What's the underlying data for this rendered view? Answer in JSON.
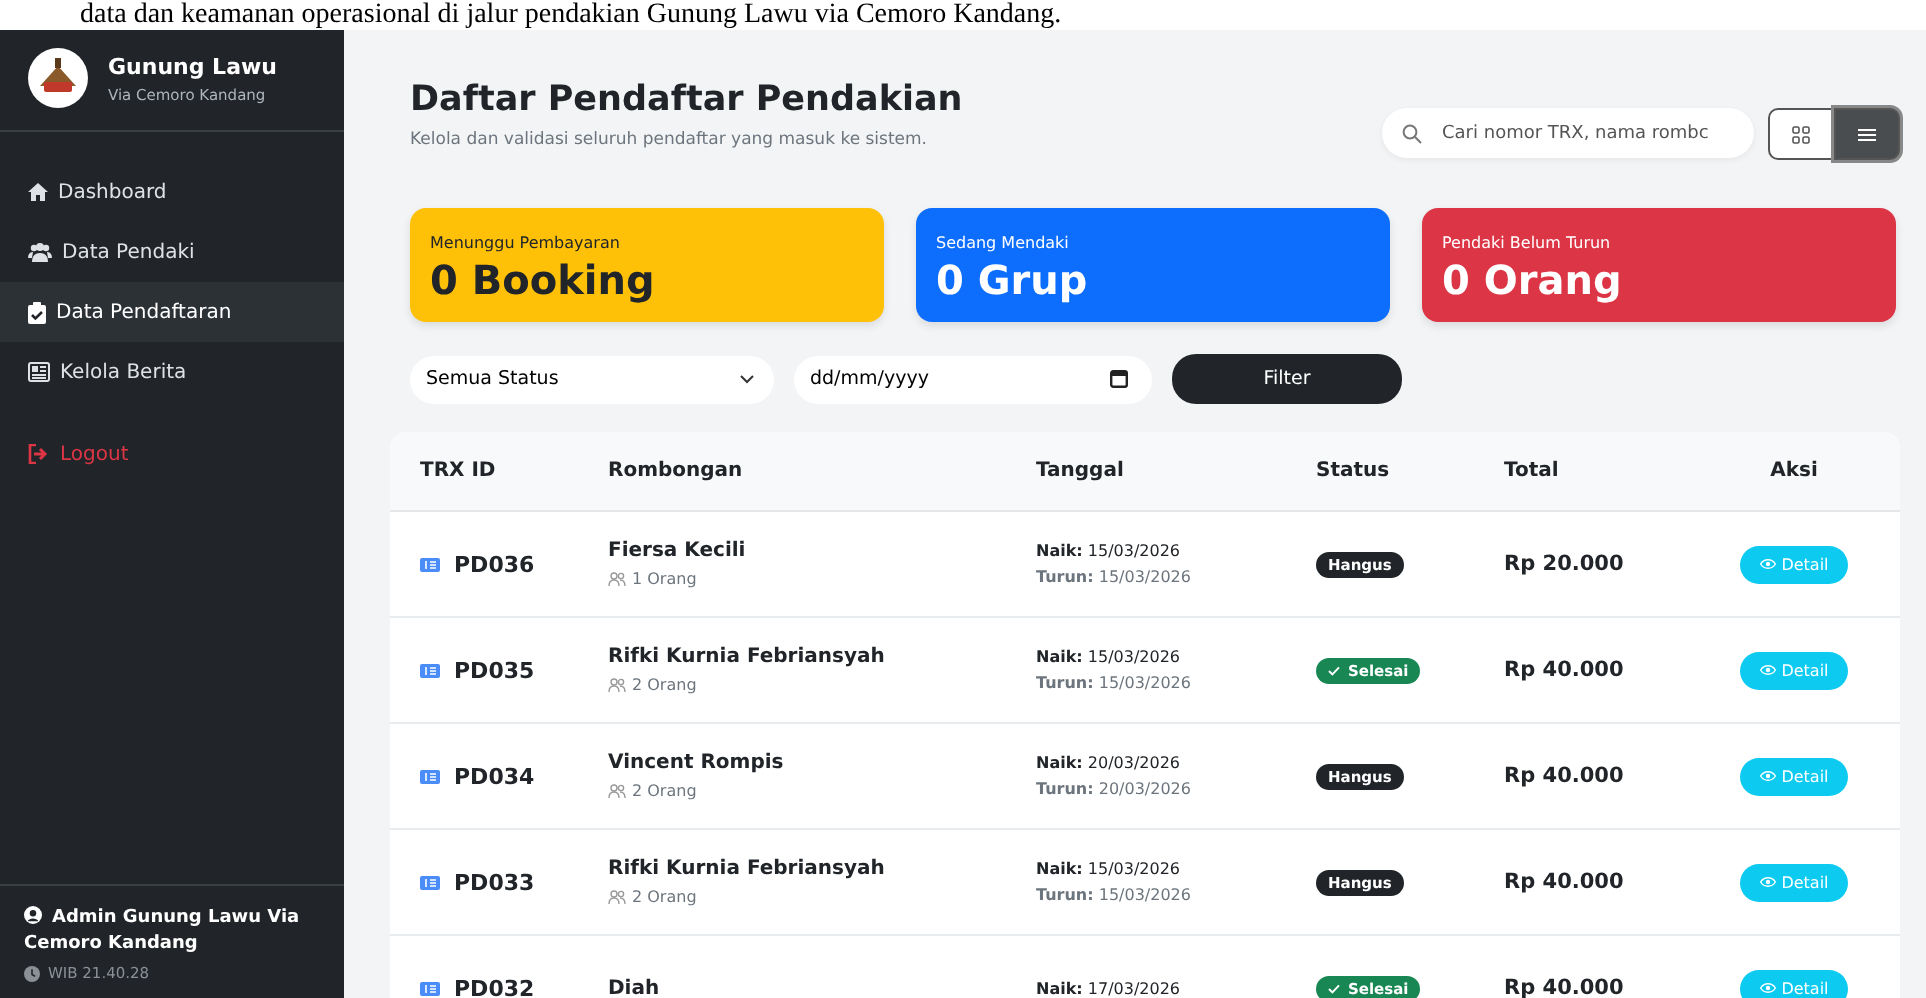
{
  "caption": "data dan keamanan operasional di jalur pendakian Gunung Lawu via Cemoro Kandang.",
  "sidebar": {
    "brand": {
      "title": "Gunung Lawu",
      "subtitle": "Via Cemoro Kandang"
    },
    "items": [
      {
        "label": "Dashboard",
        "kind": "link",
        "selected": false
      },
      {
        "label": "Data Pendaki",
        "kind": "link",
        "selected": false
      },
      {
        "label": "Data Pendaftaran",
        "kind": "link",
        "selected": true
      },
      {
        "label": "Kelola Berita",
        "kind": "link",
        "selected": false
      },
      {
        "label": "Logout",
        "kind": "logout",
        "selected": false
      }
    ],
    "user": {
      "name": "Admin Gunung Lawu Via Cemoro Kandang",
      "time": "WIB 21.40.28"
    }
  },
  "header": {
    "title": "Daftar Pendaftar Pendakian",
    "subtitle": "Kelola dan validasi seluruh pendaftar yang masuk ke sistem."
  },
  "search": {
    "placeholder": "Cari nomor TRX, nama rombc"
  },
  "view_toggle": [
    {
      "kind": "grid",
      "selected": false
    },
    {
      "kind": "list",
      "selected": true
    }
  ],
  "stats": [
    {
      "label": "Menunggu Pembayaran",
      "value": "0 Booking",
      "color": "#ffc107"
    },
    {
      "label": "Sedang Mendaki",
      "value": "0 Grup",
      "color": "#0d6efd"
    },
    {
      "label": "Pendaki Belum Turun",
      "value": "0 Orang",
      "color": "#dc3545"
    }
  ],
  "filters": {
    "status": "Semua Status",
    "date_placeholder": "dd/mm/yyyy",
    "button": "Filter"
  },
  "table": {
    "columns": [
      "TRX ID",
      "Rombongan",
      "Tanggal",
      "Status",
      "Total",
      "Aksi"
    ],
    "rows": [
      {
        "id": "PD036",
        "group": "Fiersa Kecili",
        "people": "1 Orang",
        "naik": "**Naik:** 15/03/2026",
        "turun": "**Turun:** 15/03/2026",
        "status": {
          "text": "Hangus",
          "kind": "expired"
        },
        "total": "Rp 20.000",
        "action": "Detail"
      },
      {
        "id": "PD035",
        "group": "Rifki Kurnia Febriansyah",
        "people": "2 Orang",
        "naik": "**Naik:** 15/03/2026",
        "turun": "**Turun:** 15/03/2026",
        "status": {
          "text": "Selesai",
          "kind": "done"
        },
        "total": "Rp 40.000",
        "action": "Detail"
      },
      {
        "id": "PD034",
        "group": "Vincent Rompis",
        "people": "2 Orang",
        "naik": "**Naik:** 20/03/2026",
        "turun": "**Turun:** 20/03/2026",
        "status": {
          "text": "Hangus",
          "kind": "expired"
        },
        "total": "Rp 40.000",
        "action": "Detail"
      },
      {
        "id": "PD033",
        "group": "Rifki Kurnia Febriansyah",
        "people": "2 Orang",
        "naik": "**Naik:** 15/03/2026",
        "turun": "**Turun:** 15/03/2026",
        "status": {
          "text": "Hangus",
          "kind": "expired"
        },
        "total": "Rp 40.000",
        "action": "Detail"
      },
      {
        "id": "PD032",
        "group": "Diah",
        "naik": "**Naik:** 17/03/2026",
        "status": {
          "text": "Selesai",
          "kind": "done"
        },
        "total": "Rp 40.000",
        "action": "Detail"
      }
    ]
  }
}
